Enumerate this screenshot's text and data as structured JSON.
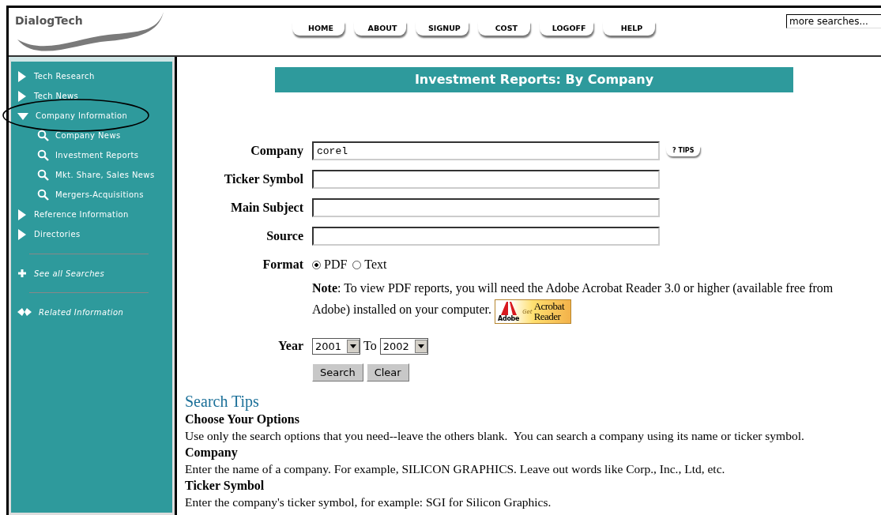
{
  "logo": {
    "text": "DialogTech"
  },
  "nav": [
    {
      "label": "HOME"
    },
    {
      "label": "ABOUT"
    },
    {
      "label": "SIGNUP"
    },
    {
      "label": "COST"
    },
    {
      "label": "LOGOFF"
    },
    {
      "label": "HELP"
    }
  ],
  "more_searches": {
    "value": "more searches..."
  },
  "sidebar": {
    "items": [
      {
        "kind": "section",
        "label": "Tech Research",
        "expanded": false,
        "circled": false
      },
      {
        "kind": "section",
        "label": "Tech News",
        "expanded": false,
        "circled": false
      },
      {
        "kind": "section",
        "label": "Company Information",
        "expanded": true,
        "circled": true,
        "children": [
          {
            "kind": "search",
            "label": "Company News"
          },
          {
            "kind": "search",
            "label": "Investment Reports"
          },
          {
            "kind": "search",
            "label": "Mkt. Share, Sales News"
          },
          {
            "kind": "search",
            "label": "Mergers-Acquisitions"
          }
        ]
      },
      {
        "kind": "section",
        "label": "Reference Information",
        "expanded": false,
        "circled": false
      },
      {
        "kind": "section",
        "label": "Directories",
        "expanded": false,
        "circled": false
      },
      {
        "kind": "divider"
      },
      {
        "kind": "plus",
        "label": "See all Searches"
      },
      {
        "kind": "divider"
      },
      {
        "kind": "related",
        "label": "Related Information"
      }
    ]
  },
  "page_title": "Investment Reports: By Company",
  "form": {
    "fields": [
      {
        "label": "Company",
        "value": "corel",
        "tips": "? TIPS"
      },
      {
        "label": "Ticker Symbol"
      },
      {
        "label": "Main Subject"
      },
      {
        "label": "Source"
      }
    ],
    "format": {
      "label": "Format",
      "options": [
        {
          "label": "PDF",
          "selected": true
        },
        {
          "label": "Text",
          "selected": false
        }
      ]
    },
    "note": "**Note**: To view PDF reports, you will need the Adobe Acrobat Reader 3.0 or higher (available free from Adobe) installed on your computer.",
    "acrobat_badge": {
      "brand": "Adobe",
      "get": "Get",
      "product_line1": "Acrobat",
      "product_line2": "Reader"
    },
    "year": {
      "label": "Year",
      "from": "2001",
      "to_label": "To",
      "to": "2002"
    },
    "buttons": [
      "Search",
      "Clear"
    ]
  },
  "search_tips": {
    "title": "Search Tips",
    "sections": [
      {
        "heading": "Choose Your Options",
        "text": "Use only the search options that you need--leave the others blank.  You can search a company using its name or ticker symbol."
      },
      {
        "heading": "Company",
        "text": "Enter the name of a company. For example, SILICON GRAPHICS. Leave out words like Corp., Inc., Ltd, etc."
      },
      {
        "heading": "Ticker Symbol",
        "text": "Enter the company's ticker symbol, for example: SGI for Silicon Graphics."
      }
    ]
  }
}
